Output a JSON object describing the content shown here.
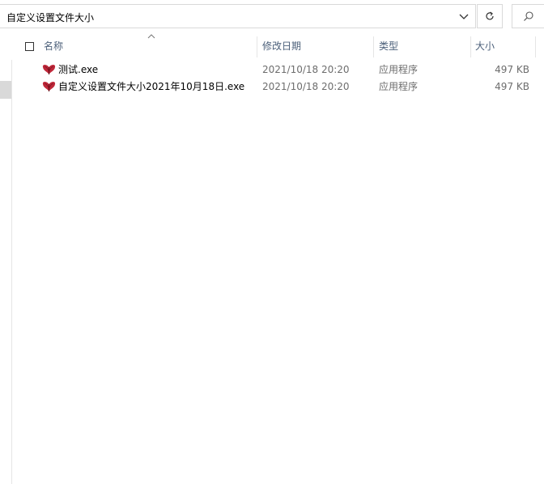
{
  "address": {
    "path": "自定义设置文件大小"
  },
  "icons": {
    "chevron": "chevron-down-icon",
    "refresh": "refresh-icon",
    "search": "search-icon",
    "sort": "sort-ascending-icon",
    "file": "butterfly-exe-icon"
  },
  "columns": {
    "name": "名称",
    "date": "修改日期",
    "type": "类型",
    "size": "大小"
  },
  "files": [
    {
      "name": "测试.exe",
      "date": "2021/10/18 20:20",
      "type": "应用程序",
      "size": "497 KB"
    },
    {
      "name": "自定义设置文件大小2021年10月18日.exe",
      "date": "2021/10/18 20:20",
      "type": "应用程序",
      "size": "497 KB"
    }
  ],
  "colors": {
    "header_text": "#4c607a",
    "meta_text": "#6d6d6d",
    "icon_red": "#c0283a"
  }
}
